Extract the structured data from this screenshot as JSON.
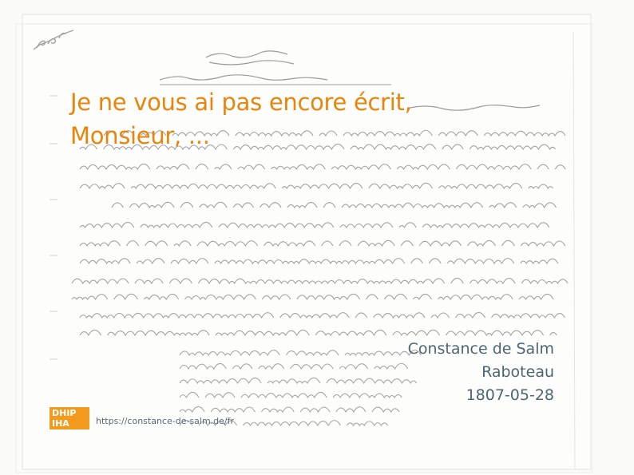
{
  "letter": {
    "headline": "Je ne vous ai pas encore écrit, Monsieur, ...",
    "author": "Constance de Salm",
    "recipient": "Raboteau",
    "date": "1807-05-28"
  },
  "footer": {
    "logo_line1": "DHIP",
    "logo_line2": "IHA",
    "url": "https://constance-de-salm.de/fr"
  },
  "colors": {
    "headline": "#e8850c",
    "meta": "#4d6673",
    "logo_bg": "#f39a1d"
  }
}
